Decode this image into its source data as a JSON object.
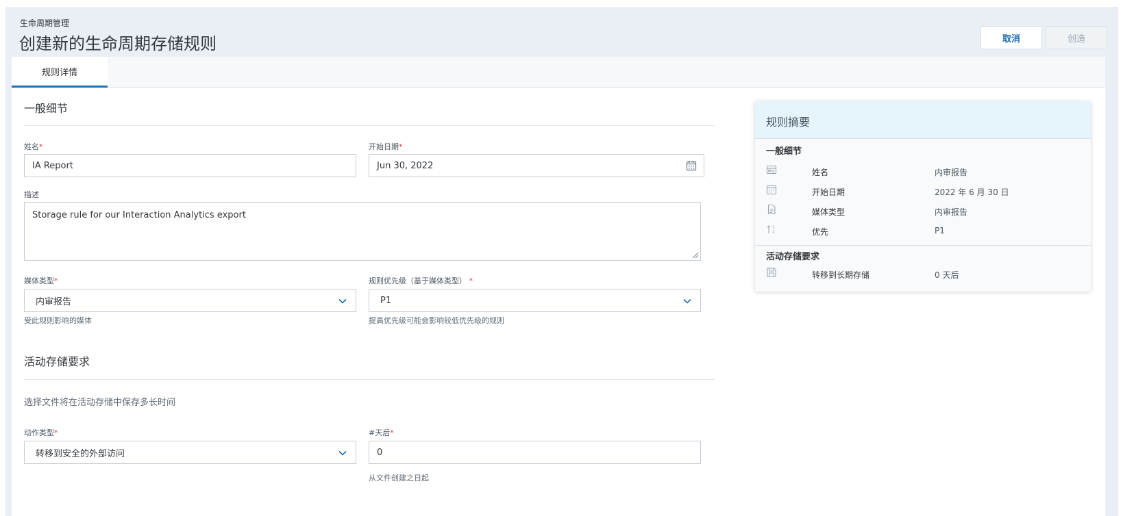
{
  "header": {
    "breadcrumb": "生命周期管理",
    "title": "创建新的生命周期存储规则",
    "cancel_label": "取消",
    "create_label": "创造"
  },
  "tabs": [
    {
      "label": "规则详情",
      "active": true
    }
  ],
  "general": {
    "section_title": "一般细节",
    "name_label": "姓名",
    "name_value": "IA Report",
    "start_label": "开始日期",
    "start_value": "Jun 30, 2022",
    "desc_label": "描述",
    "desc_value": "Storage rule for our Interaction Analytics export",
    "media_label": "媒体类型",
    "media_value": "内审报告",
    "media_helper": "受此规则影响的媒体",
    "priority_label": "规则优先级（基于媒体类型）",
    "priority_value": "P1",
    "priority_helper": "提高优先级可能会影响较低优先级的规则",
    "required_mark": "*"
  },
  "active_storage": {
    "section_title": "活动存储要求",
    "description": "选择文件将在活动存储中保存多长时间",
    "action_label": "动作类型",
    "action_value": "转移到安全的外部访问",
    "days_label": "#天后",
    "days_value": "0",
    "days_helper": "从文件创建之日起"
  },
  "summary": {
    "title": "规则摘要",
    "general_title": "一般细节",
    "rows": [
      {
        "icon": "name-card-icon",
        "key": "姓名",
        "value": "内审报告"
      },
      {
        "icon": "calendar-icon",
        "key": "开始日期",
        "value": "2022 年 6 月 30 日"
      },
      {
        "icon": "document-icon",
        "key": "媒体类型",
        "value": "内审报告"
      },
      {
        "icon": "priority-sort-icon",
        "key": "优先",
        "value": "P1"
      }
    ],
    "active_title": "活动存储要求",
    "active_rows": [
      {
        "icon": "save-disk-icon",
        "key": "转移到长期存储",
        "value": "0 天后"
      }
    ]
  },
  "colors": {
    "accent": "#1e6fb0",
    "required": "#d63b3b",
    "summary_header": "#e6f5fb",
    "page_bg": "#e9eff5"
  }
}
